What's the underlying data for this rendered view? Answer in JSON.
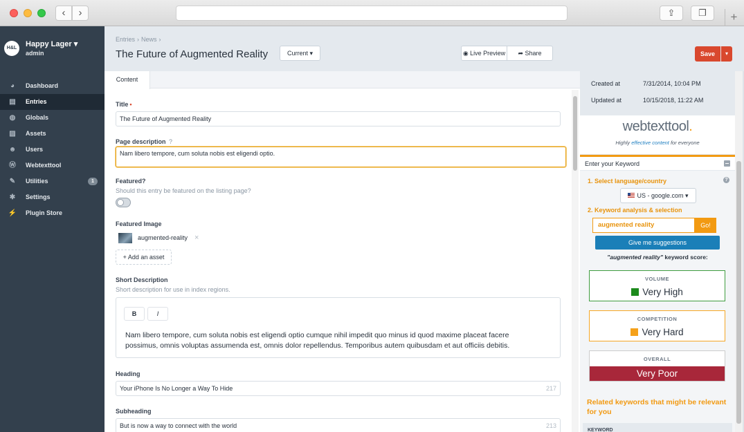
{
  "site": {
    "logo_text": "H&L",
    "name": "Happy Lager",
    "caret": "▾",
    "user": "admin"
  },
  "sidebar": {
    "items": [
      {
        "label": "Dashboard",
        "icon": "dashboard-icon",
        "glyph": "◕"
      },
      {
        "label": "Entries",
        "icon": "entries-icon",
        "glyph": "▤"
      },
      {
        "label": "Globals",
        "icon": "globe-icon",
        "glyph": "◍"
      },
      {
        "label": "Assets",
        "icon": "image-icon",
        "glyph": "▨"
      },
      {
        "label": "Users",
        "icon": "users-icon",
        "glyph": "☻"
      },
      {
        "label": "Webtexttool",
        "icon": "webtexttool-icon",
        "glyph": "Ⓦ"
      },
      {
        "label": "Utilities",
        "icon": "wrench-icon",
        "glyph": "✎",
        "badge": "1"
      },
      {
        "label": "Settings",
        "icon": "gear-icon",
        "glyph": "✱"
      },
      {
        "label": "Plugin Store",
        "icon": "plug-icon",
        "glyph": "⚡"
      }
    ]
  },
  "header": {
    "breadcrumb": [
      "Entries",
      "News"
    ],
    "breadcrumb_sep": "›",
    "title": "The Future of Augmented Reality",
    "revision": "Current ▾",
    "live_preview": "◉ Live Preview",
    "share": "➦ Share",
    "save": "Save",
    "save_menu": "▾"
  },
  "tabs": [
    "Content"
  ],
  "fields": {
    "title_label": "Title",
    "title_required": "•",
    "title_value": "The Future of Augmented Reality",
    "page_desc_label": "Page description",
    "page_desc_help": "?",
    "page_desc_value": "Nam libero tempore, cum soluta nobis est eligendi optio.",
    "featured_label": "Featured?",
    "featured_instr": "Should this entry be featured on the listing page?",
    "featured_on": false,
    "featured_image_label": "Featured Image",
    "featured_image_asset": "augmented-reality",
    "remove_glyph": "×",
    "add_asset": "+ Add an asset",
    "short_desc_label": "Short Description",
    "short_desc_instr": "Short description for use in index regions.",
    "rte_bold": "B",
    "rte_italic": "I",
    "short_desc_value": "Nam libero tempore, cum soluta nobis est eligendi optio cumque nihil impedit quo minus id quod maxime placeat facere possimus, omnis voluptas assumenda est, omnis dolor repellendus. Temporibus autem quibusdam et aut officiis debitis.",
    "heading_label": "Heading",
    "heading_value": "Your iPhone Is No Longer a Way To Hide",
    "heading_count": "217",
    "subheading_label": "Subheading",
    "subheading_value": "But is now a way to connect with the world",
    "subheading_count": "213"
  },
  "meta": {
    "created_label": "Created at",
    "created_value": "7/31/2014, 10:04 PM",
    "updated_label": "Updated at",
    "updated_value": "10/15/2018, 11:22 AM"
  },
  "webtexttool": {
    "logo_main": "webtexttool",
    "logo_dot": ".",
    "tagline_pre": "Highly ",
    "tagline_accent": "effective content",
    "tagline_post": " for everyone",
    "enter_keyword": "Enter your Keyword",
    "step1": "1. Select language/country",
    "help": "?",
    "language": "US - google.com ▾",
    "step2": "2. Keyword analysis & selection",
    "keyword": "augmented reality",
    "go": "Go!",
    "suggestions": "Give me suggestions",
    "score_keyword": "\"augmented reality\"",
    "score_suffix": " keyword score:",
    "volume_title": "VOLUME",
    "volume_value": "Very High",
    "volume_color": "#1c8a1c",
    "competition_title": "COMPETITION",
    "competition_value": "Very Hard",
    "competition_color": "#f5a11a",
    "overall_title": "OVERALL",
    "overall_value": "Very Poor",
    "overall_color": "#a8273a",
    "related_title": "Related keywords that might be relevant for you",
    "keyword_col": "KEYWORD"
  }
}
